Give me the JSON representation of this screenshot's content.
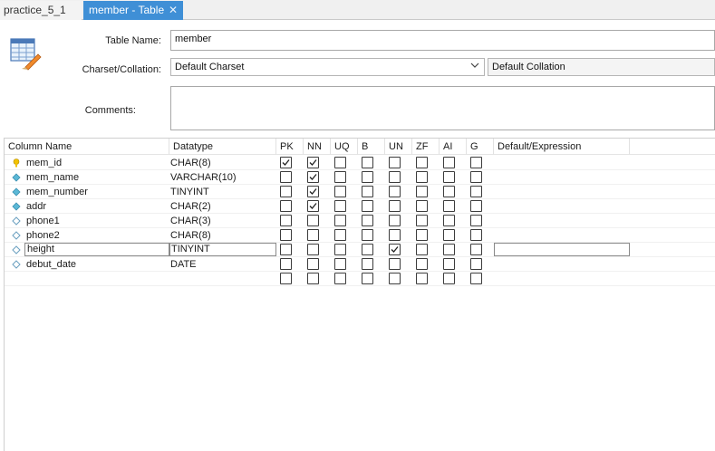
{
  "tabs": [
    {
      "label": "practice_5_1",
      "active": false
    },
    {
      "label": "member - Table",
      "active": true
    }
  ],
  "form": {
    "table_name_label": "Table Name:",
    "table_name_value": "member",
    "charset_label": "Charset/Collation:",
    "charset_value": "Default Charset",
    "collation_value": "Default Collation",
    "comments_label": "Comments:",
    "comments_value": ""
  },
  "grid": {
    "headers": {
      "name": "Column Name",
      "type": "Datatype",
      "pk": "PK",
      "nn": "NN",
      "uq": "UQ",
      "b": "B",
      "un": "UN",
      "zf": "ZF",
      "ai": "AI",
      "g": "G",
      "default": "Default/Expression"
    },
    "rows": [
      {
        "name": "mem_id",
        "type": "CHAR(8)",
        "icon": "key-icon",
        "pk": true,
        "nn": true,
        "uq": false,
        "b": false,
        "un": false,
        "zf": false,
        "ai": false,
        "g": false
      },
      {
        "name": "mem_name",
        "type": "VARCHAR(10)",
        "icon": "diamond-filled-icon",
        "pk": false,
        "nn": true,
        "uq": false,
        "b": false,
        "un": false,
        "zf": false,
        "ai": false,
        "g": false
      },
      {
        "name": "mem_number",
        "type": "TINYINT",
        "icon": "diamond-filled-icon",
        "pk": false,
        "nn": true,
        "uq": false,
        "b": false,
        "un": false,
        "zf": false,
        "ai": false,
        "g": false
      },
      {
        "name": "addr",
        "type": "CHAR(2)",
        "icon": "diamond-filled-icon",
        "pk": false,
        "nn": true,
        "uq": false,
        "b": false,
        "un": false,
        "zf": false,
        "ai": false,
        "g": false
      },
      {
        "name": "phone1",
        "type": "CHAR(3)",
        "icon": "diamond-outline-icon",
        "pk": false,
        "nn": false,
        "uq": false,
        "b": false,
        "un": false,
        "zf": false,
        "ai": false,
        "g": false
      },
      {
        "name": "phone2",
        "type": "CHAR(8)",
        "icon": "diamond-outline-icon",
        "pk": false,
        "nn": false,
        "uq": false,
        "b": false,
        "un": false,
        "zf": false,
        "ai": false,
        "g": false
      },
      {
        "name": "height",
        "type": "TINYINT",
        "icon": "diamond-outline-icon",
        "pk": false,
        "nn": false,
        "uq": false,
        "b": false,
        "un": true,
        "zf": false,
        "ai": false,
        "g": false,
        "editing": true
      },
      {
        "name": "debut_date",
        "type": "DATE",
        "icon": "diamond-outline-icon",
        "pk": false,
        "nn": false,
        "uq": false,
        "b": false,
        "un": false,
        "zf": false,
        "ai": false,
        "g": false
      },
      {
        "name": "",
        "type": "",
        "icon": "",
        "pk": false,
        "nn": false,
        "uq": false,
        "b": false,
        "un": false,
        "zf": false,
        "ai": false,
        "g": false
      }
    ]
  },
  "colors": {
    "active_tab": "#3f8fd6",
    "key_icon": "#f2c200",
    "diamond_filled": "#5bb8d6",
    "diamond_outline": "#6a9fc0"
  }
}
